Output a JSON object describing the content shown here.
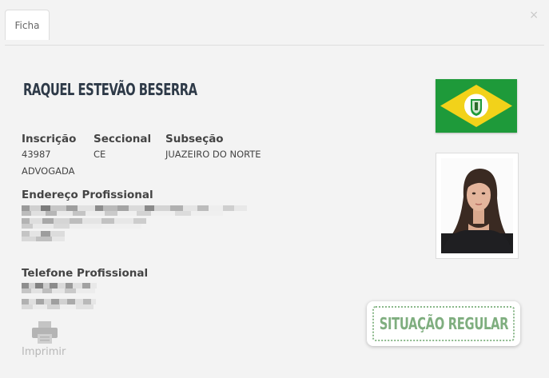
{
  "tabs": [
    {
      "label": "Ficha",
      "active": true
    }
  ],
  "close_label": "×",
  "profile": {
    "name": "RAQUEL ESTEVÃO BESERRA",
    "inscricao_label": "Inscrição",
    "inscricao": "43987",
    "seccional_label": "Seccional",
    "seccional": "CE",
    "subsecao_label": "Subseção",
    "subsecao": "JUAZEIRO DO NORTE",
    "tipo": "ADVOGADA",
    "endereco_label": "Endereço Profissional",
    "telefone_label": "Telefone Profissional"
  },
  "actions": {
    "print_label": "Imprimir",
    "print_icon": "printer-icon"
  },
  "status": {
    "label": "SITUAÇÃO REGULAR",
    "color": "#7fae7f"
  },
  "colors": {
    "flag_green": "#1e9a3a",
    "flag_yellow": "#f2d21a",
    "name_color": "#2e3a48"
  }
}
